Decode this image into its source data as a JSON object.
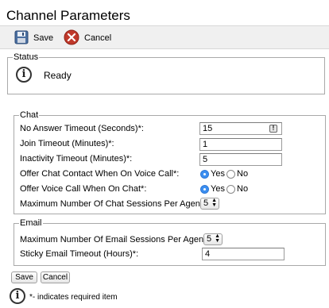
{
  "page": {
    "title": "Channel Parameters"
  },
  "toolbar": {
    "save_label": "Save",
    "cancel_label": "Cancel"
  },
  "status": {
    "legend": "Status",
    "text": "Ready"
  },
  "chat": {
    "legend": "Chat",
    "no_answer_label": "No Answer Timeout (Seconds)*:",
    "no_answer_value": "15",
    "join_label": "Join Timeout (Minutes)*:",
    "join_value": "1",
    "inactivity_label": "Inactivity Timeout (Minutes)*:",
    "inactivity_value": "5",
    "offer_chat_label": "Offer Chat Contact When On Voice Call*:",
    "offer_chat_selected": "Yes",
    "offer_voice_label": "Offer Voice Call When On Chat*:",
    "offer_voice_selected": "Yes",
    "max_sessions_label": "Maximum Number Of Chat Sessions Per Agent*:",
    "max_sessions_value": "5",
    "yes_label": "Yes",
    "no_label": "No"
  },
  "email": {
    "legend": "Email",
    "max_sessions_label": "Maximum Number Of Email Sessions Per Agent*:",
    "max_sessions_value": "5",
    "sticky_label": "Sticky Email Timeout (Hours)*:",
    "sticky_value": "4"
  },
  "footer": {
    "save_label": "Save",
    "cancel_label": "Cancel",
    "note": "*- indicates required item"
  },
  "icons": {
    "save": "floppy-disk-icon",
    "cancel": "cancel-x-icon",
    "info": "info-icon",
    "input_helper": "input-helper-icon"
  },
  "colors": {
    "cancel_red": "#c0392b",
    "radio_selected": "#3b8ef0"
  }
}
